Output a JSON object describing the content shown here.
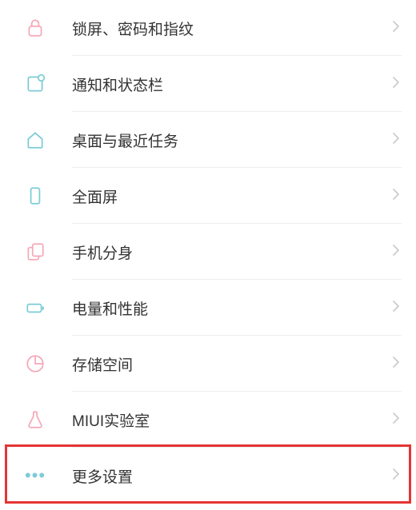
{
  "settings": {
    "items": [
      {
        "id": "lock",
        "label": "锁屏、密码和指纹"
      },
      {
        "id": "notification",
        "label": "通知和状态栏"
      },
      {
        "id": "home",
        "label": "桌面与最近任务"
      },
      {
        "id": "fullscreen",
        "label": "全面屏"
      },
      {
        "id": "second-space",
        "label": "手机分身"
      },
      {
        "id": "battery",
        "label": "电量和性能"
      },
      {
        "id": "storage",
        "label": "存储空间"
      },
      {
        "id": "miui-lab",
        "label": "MIUI实验室"
      },
      {
        "id": "more",
        "label": "更多设置"
      }
    ]
  },
  "colors": {
    "pink": "#f5a8b8",
    "teal": "#7cccd7",
    "highlight": "#e63434"
  }
}
